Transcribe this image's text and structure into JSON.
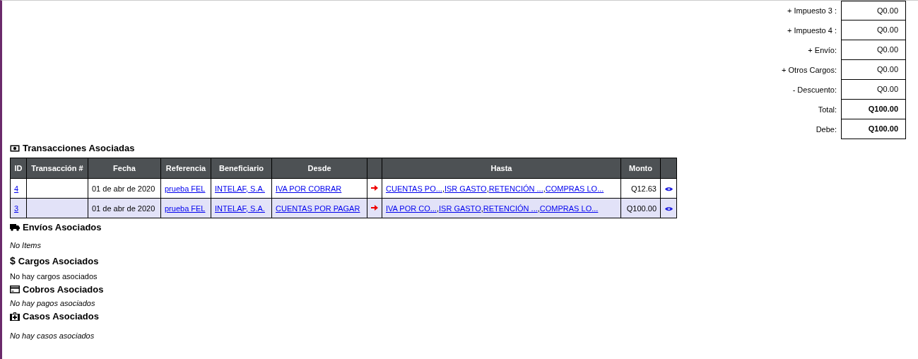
{
  "totals": [
    {
      "label": "+ Impuesto 3 :",
      "value": "Q0.00",
      "bold": false
    },
    {
      "label": "+ Impuesto 4 :",
      "value": "Q0.00",
      "bold": false
    },
    {
      "label": "+ Envío:",
      "value": "Q0.00",
      "bold": false
    },
    {
      "label": "+ Otros Cargos:",
      "value": "Q0.00",
      "bold": false
    },
    {
      "label": "- Descuento:",
      "value": "Q0.00",
      "bold": false
    },
    {
      "label": "Total:",
      "value": "Q100.00",
      "bold": true
    },
    {
      "label": "Debe:",
      "value": "Q100.00",
      "bold": true
    }
  ],
  "transactions": {
    "title": "Transacciones Asociadas",
    "columns": [
      "ID",
      "Transacción #",
      "Fecha",
      "Referencia",
      "Beneficiario",
      "Desde",
      "",
      "Hasta",
      "Monto",
      ""
    ],
    "rows": [
      {
        "id": "4",
        "fecha": "01 de abr de 2020",
        "referencia": "prueba FEL",
        "beneficiario": "INTELAF, S.A.",
        "desde": "IVA POR COBRAR",
        "hasta": [
          "CUENTAS PO...",
          "ISR GASTO",
          "RETENCIÓN ...",
          "COMPRAS LO..."
        ],
        "separator": ",",
        "monto": "Q12.63",
        "shaded": false
      },
      {
        "id": "3",
        "fecha": "01 de abr de 2020",
        "referencia": "prueba FEL",
        "beneficiario": "INTELAF, S.A.",
        "desde": "CUENTAS POR PAGAR",
        "hasta": [
          "IVA POR CO...",
          "ISR GASTO",
          "RETENCIÓN ...",
          "COMPRAS LO..."
        ],
        "separator": ",",
        "monto": "Q100.00",
        "shaded": true
      }
    ]
  },
  "sections": [
    {
      "kind": "truck",
      "title": "Envíos Asociados",
      "note": "No Items",
      "italic": true
    },
    {
      "kind": "dollar",
      "symbol": "$",
      "title": "Cargos Asociados",
      "note": "No hay cargos asociados",
      "italic": false
    },
    {
      "kind": "card",
      "title": "Cobros Asociados",
      "note": "No hay pagos asociados",
      "italic": true
    },
    {
      "kind": "medkit",
      "title": "Casos Asociados",
      "note": "No hay casos asociados",
      "italic": true
    }
  ]
}
